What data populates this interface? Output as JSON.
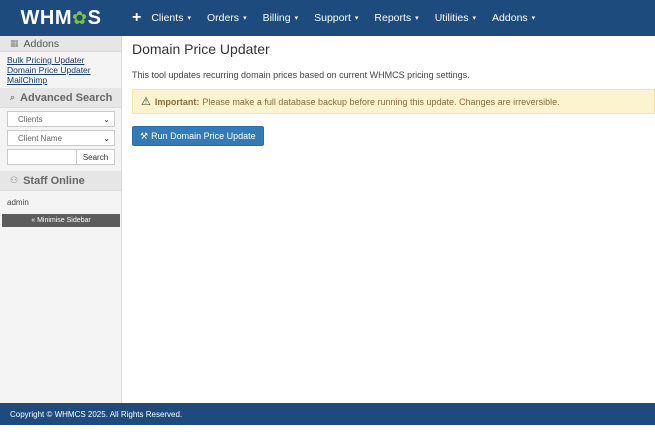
{
  "header": {
    "logo_text": "WHMCS",
    "logo_prefix": "WHM",
    "logo_gear": "✿",
    "logo_suffix": "S",
    "add_icon": "+",
    "nav": [
      {
        "label": "Clients"
      },
      {
        "label": "Orders"
      },
      {
        "label": "Billing"
      },
      {
        "label": "Support"
      },
      {
        "label": "Reports"
      },
      {
        "label": "Utilities"
      },
      {
        "label": "Addons"
      }
    ],
    "caret": "▾"
  },
  "sidebar": {
    "addons_title": "Addons",
    "addon_links": [
      "Bulk Pricing Updater",
      "Domain Price Updater",
      "MailChimp"
    ],
    "advanced_search_title": "Advanced Search",
    "select_type": "Clients",
    "select_field": "Client Name",
    "search_button": "Search",
    "staff_online_title": "Staff Online",
    "staff_user": "admin",
    "minimise_label": "« Minimise Sidebar"
  },
  "main": {
    "title": "Domain Price Updater",
    "description": "This tool updates recurring domain prices based on current WHMCS pricing settings.",
    "alert_strong": "Important:",
    "alert_text": "Please make a full database backup before running this update. Changes are irreversible.",
    "run_button_label": "Run Domain Price Update"
  },
  "footer": {
    "copyright": "Copyright © WHMCS 2025. All Rights Reserved."
  },
  "colors": {
    "brand_blue": "#1d4b7e",
    "primary_button": "#337ab7",
    "logo_accent": "#7ec242",
    "alert_bg": "#fcf3cf"
  },
  "icons": {
    "addons": "puzzle-icon",
    "advanced_search": "binoculars-icon",
    "staff_online": "users-icon",
    "alert": "warning-icon",
    "run": "tools-icon"
  }
}
